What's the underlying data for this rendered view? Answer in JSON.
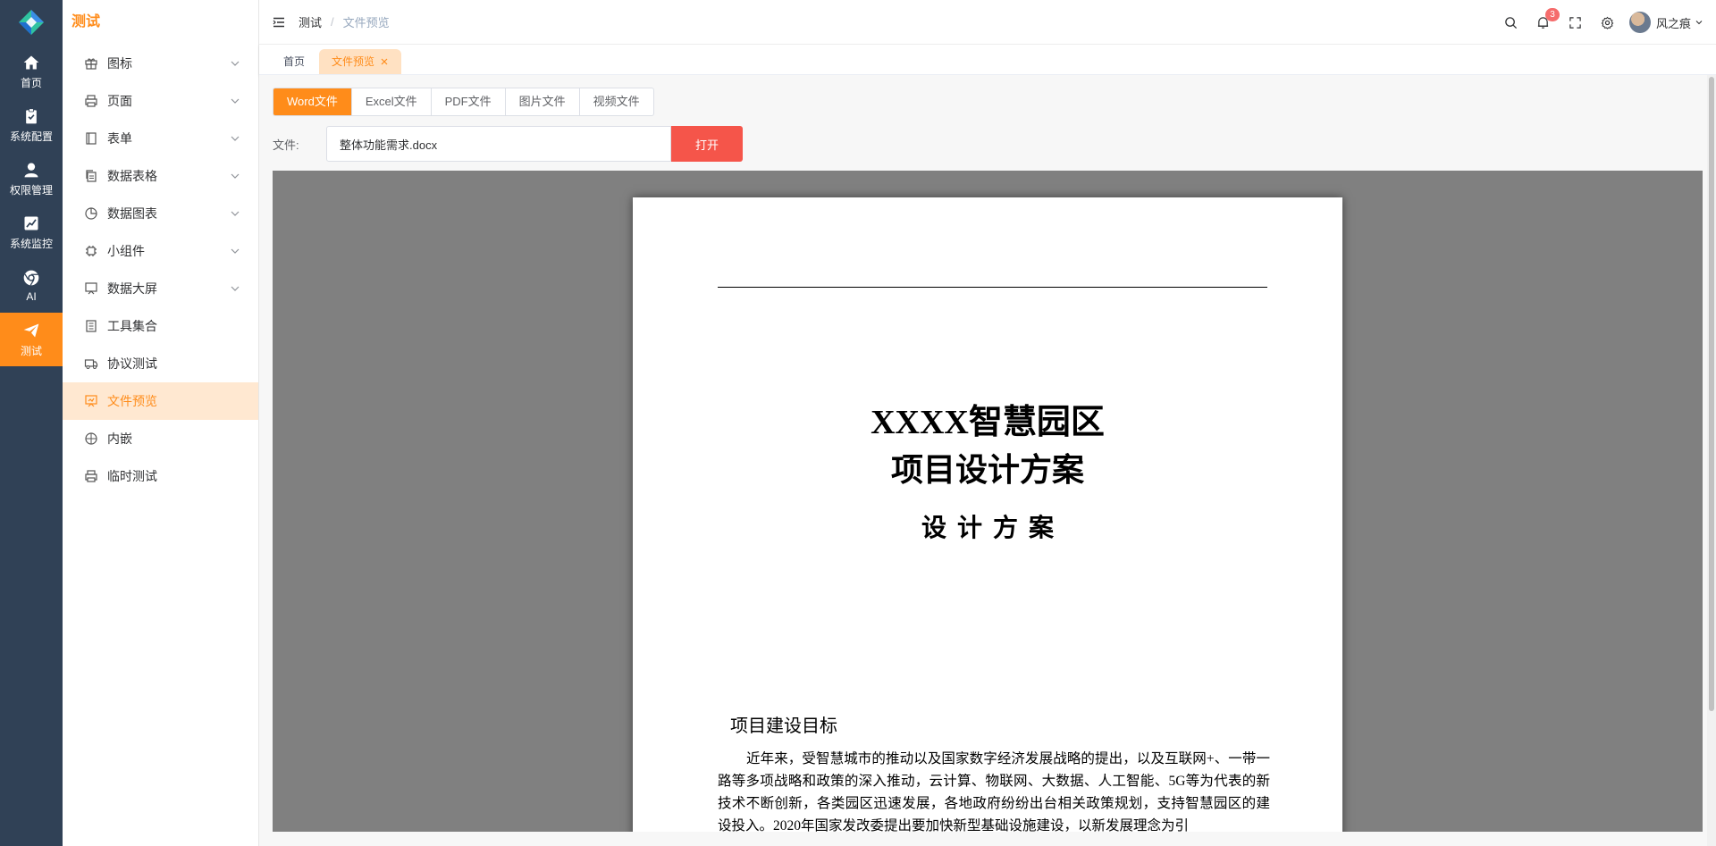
{
  "rail": {
    "items": [
      {
        "label": "首页",
        "icon": "home-icon"
      },
      {
        "label": "系统配置",
        "icon": "clipboard-check-icon"
      },
      {
        "label": "权限管理",
        "icon": "user-icon"
      },
      {
        "label": "系统监控",
        "icon": "line-chart-icon"
      },
      {
        "label": "AI",
        "icon": "chrome-icon"
      },
      {
        "label": "测试",
        "icon": "send-icon",
        "active": true
      }
    ]
  },
  "sidebar": {
    "title": "测试",
    "items": [
      {
        "label": "图标",
        "icon": "gift-icon",
        "has_children": true
      },
      {
        "label": "页面",
        "icon": "printer-icon",
        "has_children": true
      },
      {
        "label": "表单",
        "icon": "notebook-icon",
        "has_children": true
      },
      {
        "label": "数据表格",
        "icon": "copy-document-icon",
        "has_children": true
      },
      {
        "label": "数据图表",
        "icon": "pie-chart-icon",
        "has_children": true
      },
      {
        "label": "小组件",
        "icon": "cpu-icon",
        "has_children": true
      },
      {
        "label": "数据大屏",
        "icon": "data-board-icon",
        "has_children": true
      },
      {
        "label": "工具集合",
        "icon": "tickets-icon",
        "has_children": false
      },
      {
        "label": "协议测试",
        "icon": "van-icon",
        "has_children": false
      },
      {
        "label": "文件预览",
        "icon": "data-analysis-icon",
        "has_children": false,
        "active": true
      },
      {
        "label": "内嵌",
        "icon": "basketball-icon",
        "has_children": false
      },
      {
        "label": "临时测试",
        "icon": "printer-icon",
        "has_children": false
      }
    ]
  },
  "header": {
    "breadcrumb": [
      "测试",
      "文件预览"
    ],
    "notification_count": "3",
    "username": "风之痕"
  },
  "tags": [
    {
      "label": "首页",
      "active": false
    },
    {
      "label": "文件预览",
      "active": true
    }
  ],
  "main": {
    "file_tabs": [
      "Word文件",
      "Excel文件",
      "PDF文件",
      "图片文件",
      "视频文件"
    ],
    "active_tab": "Word文件",
    "file_label": "文件:",
    "file_value": "整体功能需求.docx",
    "open_button": "打开"
  },
  "document": {
    "title_line1": "XXXX智慧园区",
    "title_line2": "项目设计方案",
    "subtitle": "设计方案",
    "section_heading": "项目建设目标",
    "paragraph": "近年来，受智慧城市的推动以及国家数字经济发展战略的提出，以及互联网+、一带一路等多项战略和政策的深入推动，云计算、物联网、大数据、人工智能、5G等为代表的新技术不断创新，各类园区迅速发展，各地政府纷纷出台相关政策规划，支持智慧园区的建设投入。2020年国家发改委提出要加快新型基础设施建设，以新发展理念为引"
  },
  "colors": {
    "accent": "#ff8c1a",
    "rail_bg": "#304156",
    "open_button": "#f5554a",
    "badge": "#f56c6c",
    "viewer_bg": "#808080"
  }
}
